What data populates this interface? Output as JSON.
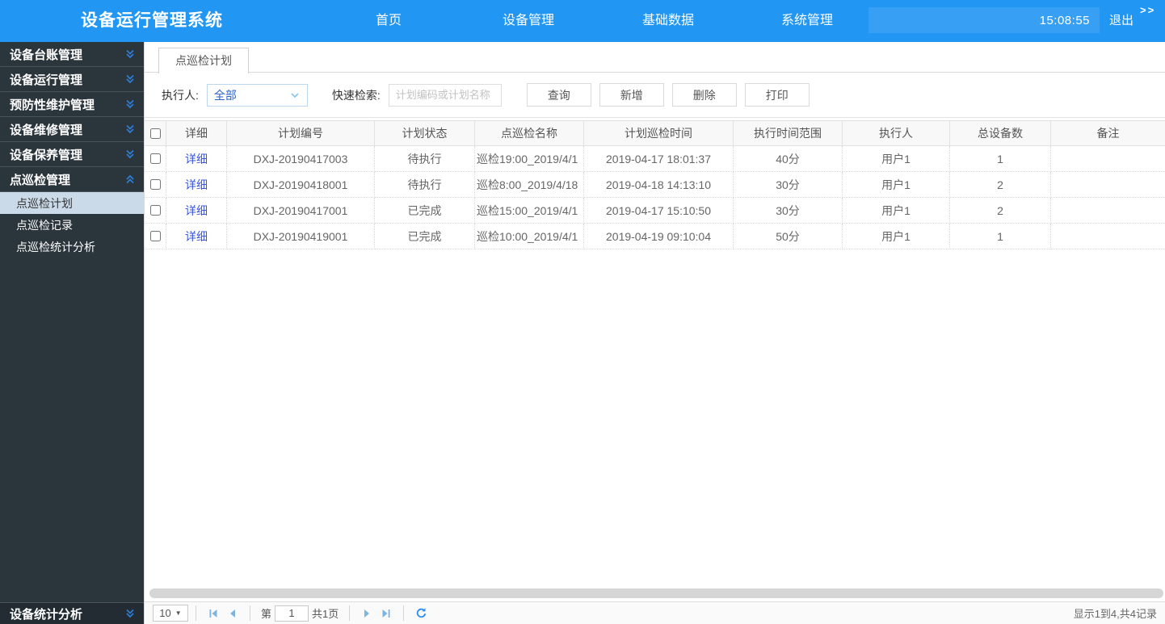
{
  "header": {
    "title": "设备运行管理系统",
    "nav": [
      {
        "label": "首页"
      },
      {
        "label": "设备管理"
      },
      {
        "label": "基础数据"
      },
      {
        "label": "系统管理"
      }
    ],
    "clock": "15:08:55",
    "logout_label": "退出",
    "collapse_label": ">>"
  },
  "sidebar": {
    "sections": [
      {
        "label": "设备台账管理",
        "state": "collapsed"
      },
      {
        "label": "设备运行管理",
        "state": "collapsed"
      },
      {
        "label": "预防性维护管理",
        "state": "collapsed"
      },
      {
        "label": "设备维修管理",
        "state": "collapsed"
      },
      {
        "label": "设备保养管理",
        "state": "collapsed"
      },
      {
        "label": "点巡检管理",
        "state": "expanded"
      }
    ],
    "subitems": [
      {
        "label": "点巡检计划",
        "selected": true
      },
      {
        "label": "点巡检记录",
        "selected": false
      },
      {
        "label": "点巡检统计分析",
        "selected": false
      }
    ],
    "bottom_section": {
      "label": "设备统计分析",
      "state": "collapsed"
    }
  },
  "tabs": {
    "active": "点巡检计划"
  },
  "toolbar": {
    "executor_label": "执行人:",
    "executor_value": "全部",
    "search_label": "快速检索:",
    "search_placeholder": "计划编码或计划名称",
    "buttons": [
      {
        "label": "查询"
      },
      {
        "label": "新增"
      },
      {
        "label": "删除"
      },
      {
        "label": "打印"
      }
    ]
  },
  "table": {
    "detail_link_label": "详细",
    "columns": [
      "详细",
      "计划编号",
      "计划状态",
      "点巡检名称",
      "计划巡检时间",
      "执行时间范围",
      "执行人",
      "总设备数",
      "备注"
    ],
    "rows": [
      {
        "plan_no": "DXJ-20190417003",
        "status": "待执行",
        "name": "巡检19:00_2019/4/1",
        "time": "2019-04-17 18:01:37",
        "range": "40分",
        "executor": "用户1",
        "devices": "1",
        "remark": ""
      },
      {
        "plan_no": "DXJ-20190418001",
        "status": "待执行",
        "name": "巡检8:00_2019/4/18",
        "time": "2019-04-18 14:13:10",
        "range": "30分",
        "executor": "用户1",
        "devices": "2",
        "remark": ""
      },
      {
        "plan_no": "DXJ-20190417001",
        "status": "已完成",
        "name": "巡检15:00_2019/4/1",
        "time": "2019-04-17 15:10:50",
        "range": "30分",
        "executor": "用户1",
        "devices": "2",
        "remark": ""
      },
      {
        "plan_no": "DXJ-20190419001",
        "status": "已完成",
        "name": "巡检10:00_2019/4/1",
        "time": "2019-04-19 09:10:04",
        "range": "50分",
        "executor": "用户1",
        "devices": "1",
        "remark": ""
      }
    ]
  },
  "pagination": {
    "page_size": "10",
    "page_prefix": "第",
    "page_value": "1",
    "page_suffix": "共1页",
    "summary": "显示1到4,共4记录"
  },
  "icons": {
    "sidebar_collapsed": "chevron-double-down",
    "sidebar_expanded": "chevron-double-up",
    "select_arrow": "chevron-down",
    "pager": [
      "first-page",
      "prev-page",
      "next-page",
      "last-page",
      "refresh"
    ]
  },
  "colors": {
    "header_bg": "#2196f3",
    "sidebar_bg": "#2b353c",
    "selected_item_bg": "#cbdae8",
    "link_color": "#3956d6",
    "accent_blue": "#2d8cf0",
    "pager_icon": "#7db4e0"
  }
}
